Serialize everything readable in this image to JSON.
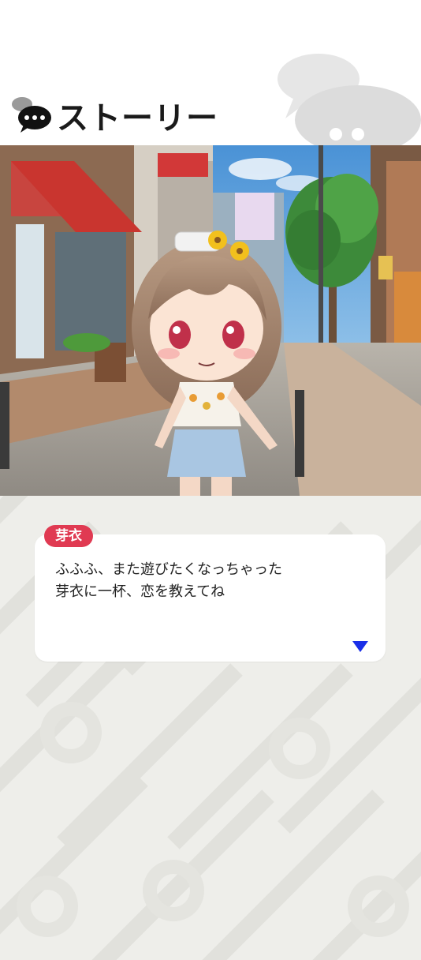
{
  "header": {
    "title": "ストーリー",
    "icon": "chat-bubble-icon"
  },
  "scene": {
    "description_icon": "character-scene"
  },
  "dialog": {
    "speaker": "芽衣",
    "lines": [
      "ふふふ、また遊びたくなっちゃった",
      "芽衣に一杯、恋を教えてね"
    ],
    "next_icon": "triangle-down-icon"
  },
  "colors": {
    "accent": "#e03a52",
    "arrow": "#1a2fe8",
    "background": "#eeeeea"
  }
}
